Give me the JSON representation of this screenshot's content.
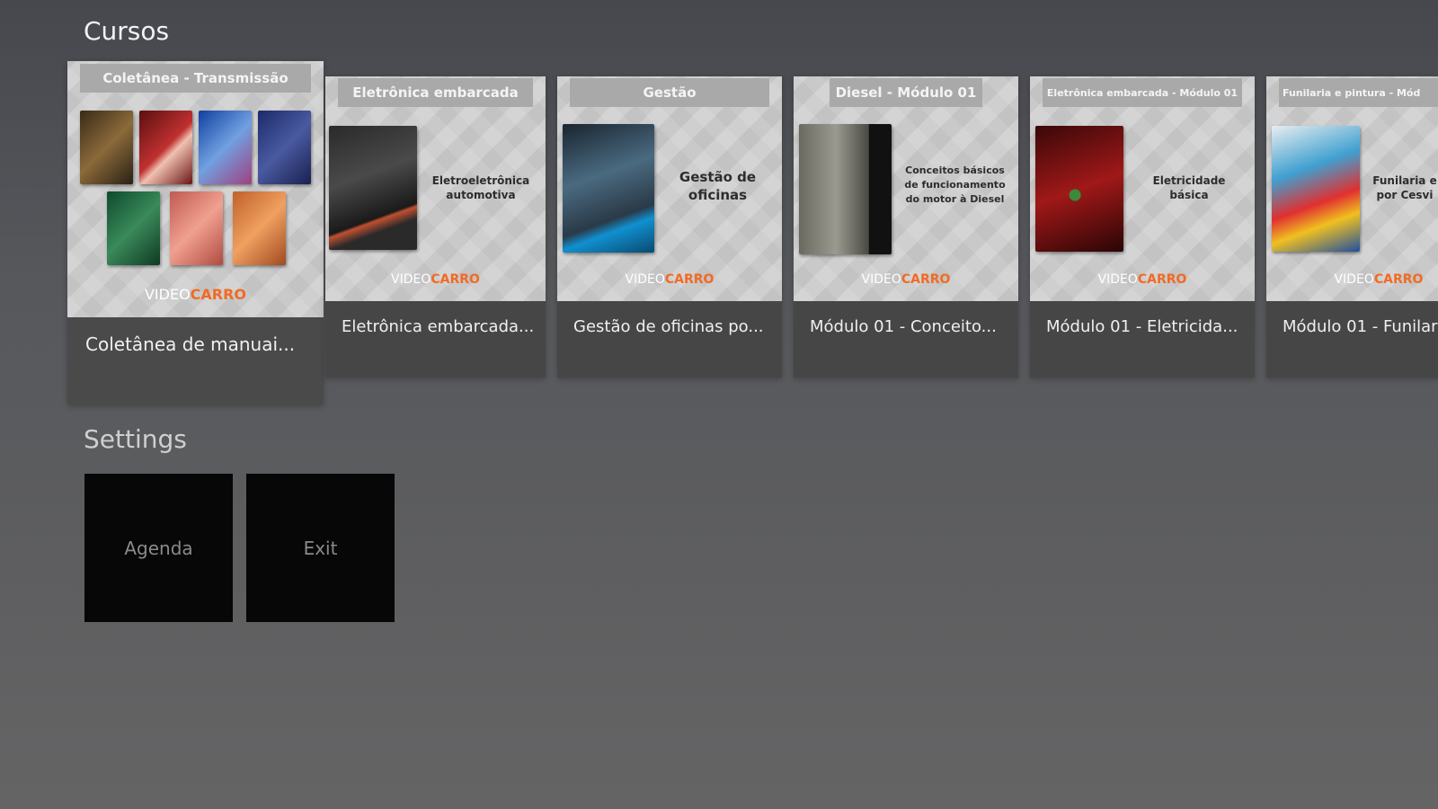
{
  "rows": {
    "cursos": {
      "title": "Cursos",
      "cards": [
        {
          "tag": "Coletânea - Transmissão",
          "description": "",
          "caption": "Coletânea de manuai..."
        },
        {
          "tag": "Eletrônica embarcada",
          "description": "Eletroeletrônica\nautomotiva",
          "caption": "Eletrônica embarcada..."
        },
        {
          "tag": "Gestão",
          "description": "Gestão de\noficinas",
          "caption": "Gestão de oficinas po..."
        },
        {
          "tag": "Diesel - Módulo 01",
          "description": "Conceitos básicos\nde funcionamento\ndo motor à Diesel",
          "caption": "Módulo 01 - Conceito..."
        },
        {
          "tag": "Eletrônica embarcada - Módulo 01",
          "description": "Eletricidade\nbásica",
          "caption": "Módulo 01 - Eletricida..."
        },
        {
          "tag": "Funilaria e pintura - Mód",
          "description": "Funilaria e\npor Cesvi",
          "caption": "Módulo 01 - Funilar"
        }
      ]
    },
    "settings": {
      "title": "Settings",
      "tiles": [
        {
          "label": "Agenda"
        },
        {
          "label": "Exit"
        }
      ]
    }
  },
  "brand": {
    "video": "VIDEO",
    "carro": "CARRO"
  },
  "colors": {
    "brand_orange": "#f26a24",
    "card_caption_bg": "#464646",
    "tile_bg": "#070707",
    "tag_bg": "#a9a9a9"
  }
}
